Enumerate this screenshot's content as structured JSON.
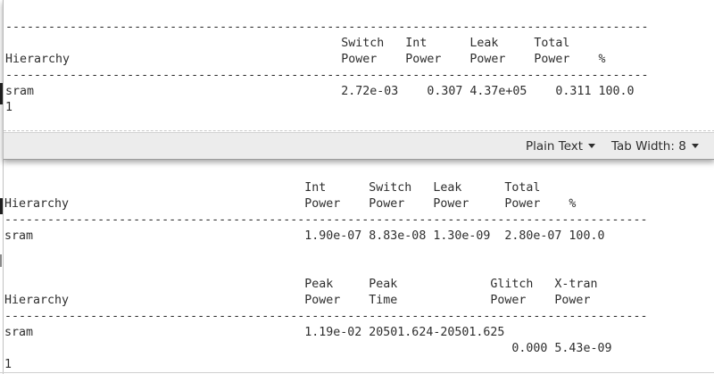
{
  "top_editor": {
    "divider": "--------------------------------------------------------------------------------------------------------",
    "header_row1": "                                               Switch   Int      Leak     Total",
    "header_row2": "Hierarchy                                      Power    Power    Power    Power    %",
    "divider2": "--------------------------------------------------------------------------------------------------------",
    "sram_row": "sram                                           2.72e-03    0.307 4.37e+05    0.311 100.0",
    "row_one": "1"
  },
  "statusbar": {
    "language_label": "Plain Text",
    "tab_width_label": "Tab Width: 8"
  },
  "bottom_report": {
    "power_header_row1": "                                          Int      Switch   Leak      Total",
    "power_header_row2": "Hierarchy                                 Power    Power    Power     Power    %",
    "power_divider": "--------------------------------------------------------------------------------------------------------",
    "power_sram_row": "sram                                      1.90e-07 8.83e-08 1.30e-09  2.80e-07 100.0",
    "peak_header_row1": "                                          Peak     Peak             Glitch   X-tran",
    "peak_header_row2": "Hierarchy                                 Power    Time             Power    Power",
    "peak_divider": "--------------------------------------------------------------------------------------------------------",
    "peak_sram_row": "sram                                      1.19e-02 20501.624-20501.625",
    "peak_values_row": "                                                                       0.000 5.43e-09",
    "row_one": "1"
  }
}
